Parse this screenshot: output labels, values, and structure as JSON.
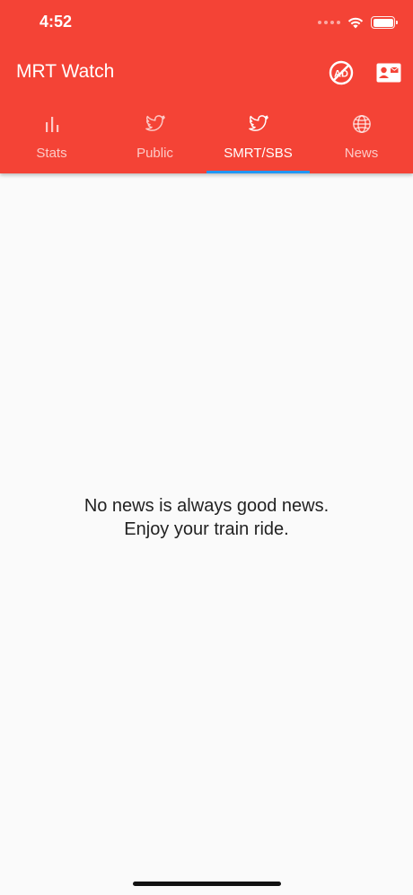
{
  "status_bar": {
    "time": "4:52"
  },
  "app_bar": {
    "title": "MRT Watch",
    "background_color": "#f44336",
    "actions": [
      {
        "icon": "no-ads-icon"
      },
      {
        "icon": "contact-card-icon"
      }
    ]
  },
  "tabs": [
    {
      "label": "Stats",
      "icon": "bar-chart-icon",
      "active": false
    },
    {
      "label": "Public",
      "icon": "twitter-bird-icon",
      "active": false
    },
    {
      "label": "SMRT/SBS",
      "icon": "twitter-bird-icon",
      "active": true
    },
    {
      "label": "News",
      "icon": "globe-icon",
      "active": false
    }
  ],
  "tab_indicator_color": "#2196f3",
  "content": {
    "message_line1": "No news is always good news.",
    "message_line2": "Enjoy your train ride."
  }
}
